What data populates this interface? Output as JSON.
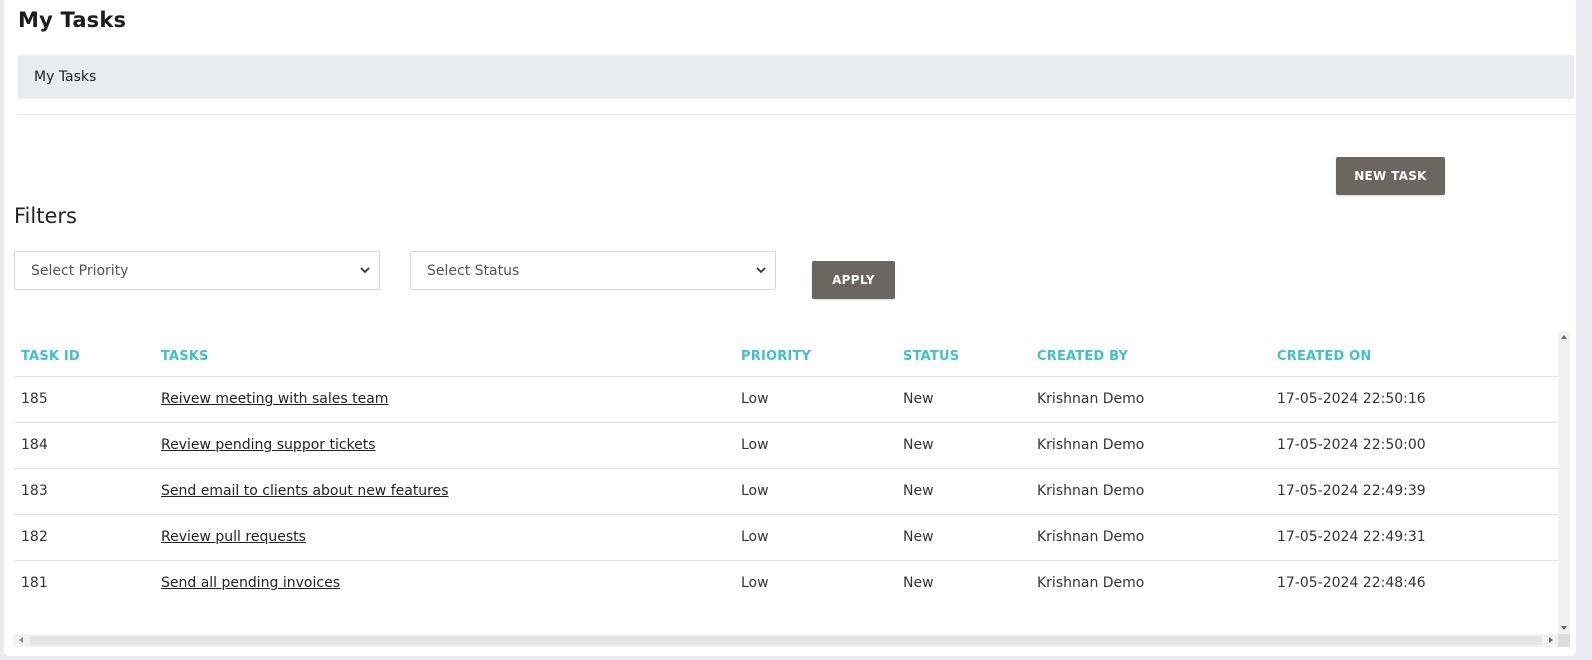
{
  "page": {
    "title": "My Tasks",
    "breadcrumb": "My Tasks"
  },
  "actions": {
    "new_task_label": "NEW TASK",
    "apply_label": "APPLY"
  },
  "filters": {
    "heading": "Filters",
    "priority_placeholder": "Select Priority",
    "status_placeholder": "Select Status"
  },
  "table": {
    "headers": [
      "TASK ID",
      "TASKS",
      "PRIORITY",
      "STATUS",
      "CREATED BY",
      "CREATED ON"
    ],
    "rows": [
      {
        "id": "185",
        "task": "Reivew meeting with sales team",
        "priority": "Low",
        "status": "New",
        "created_by": "Krishnan Demo",
        "created_on": "17-05-2024 22:50:16"
      },
      {
        "id": "184",
        "task": "Review pending suppor tickets",
        "priority": "Low",
        "status": "New",
        "created_by": "Krishnan Demo",
        "created_on": "17-05-2024 22:50:00"
      },
      {
        "id": "183",
        "task": "Send email to clients about new features",
        "priority": "Low",
        "status": "New",
        "created_by": "Krishnan Demo",
        "created_on": "17-05-2024 22:49:39"
      },
      {
        "id": "182",
        "task": "Review pull requests",
        "priority": "Low",
        "status": "New",
        "created_by": "Krishnan Demo",
        "created_on": "17-05-2024 22:49:31"
      },
      {
        "id": "181",
        "task": "Send all pending invoices",
        "priority": "Low",
        "status": "New",
        "created_by": "Krishnan Demo",
        "created_on": "17-05-2024 22:48:46"
      }
    ]
  },
  "colors": {
    "header_text": "#3fc1c9",
    "button_bg": "#6c6661",
    "breadcrumb_bg": "#e8ecef"
  },
  "icons": {
    "select_chevron": "chevron-down-icon"
  }
}
